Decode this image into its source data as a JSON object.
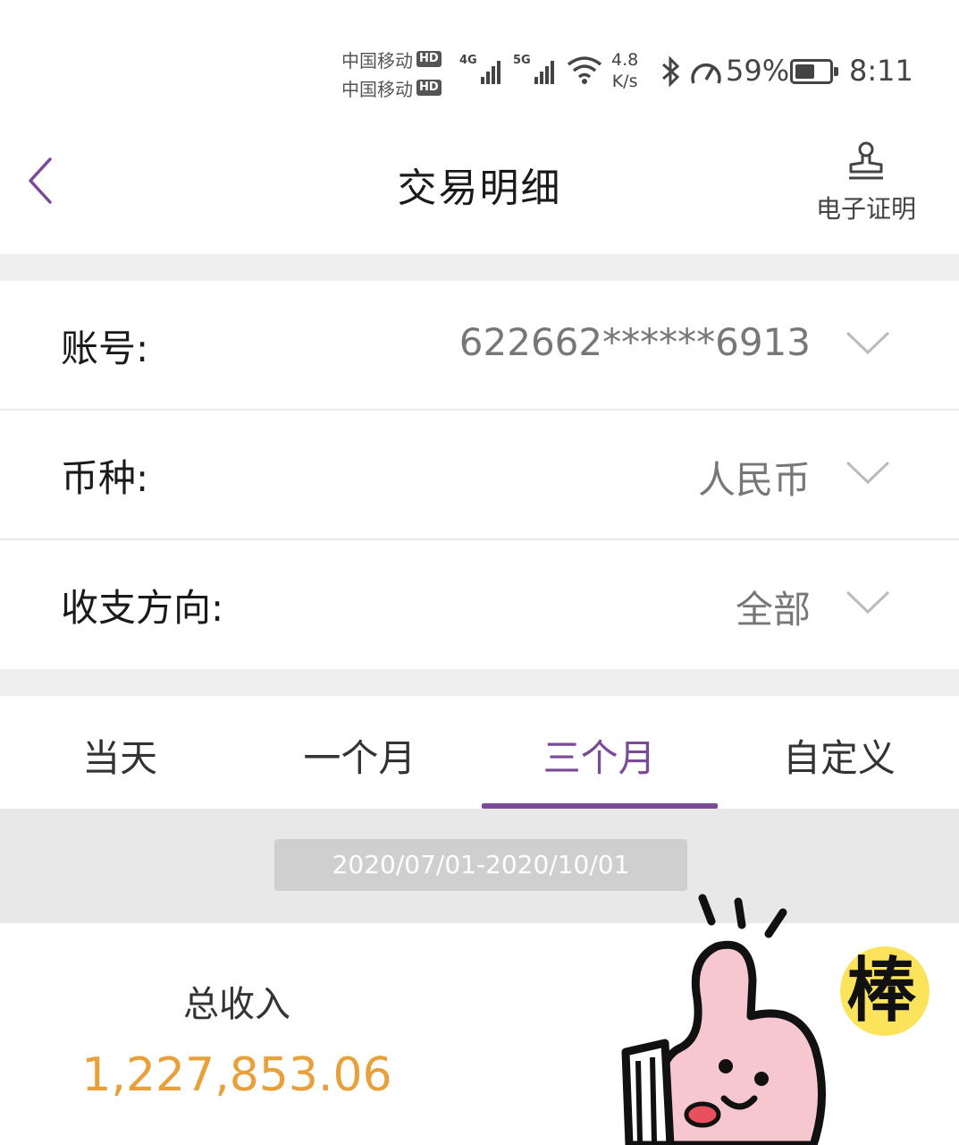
{
  "status_bar": {
    "carrier1": "中国移动",
    "carrier2": "中国移动",
    "hd_badge": "HD",
    "net1": "4G",
    "net2": "5G",
    "speed_value": "4.8",
    "speed_unit": "K/s",
    "battery_percent": "59%",
    "battery_level": 0.59,
    "time": "8:11"
  },
  "header": {
    "title": "交易明细",
    "cert_label": "电子证明"
  },
  "form": {
    "account_label": "账号:",
    "account_value": "622662******6913",
    "currency_label": "币种:",
    "currency_value": "人民币",
    "direction_label": "收支方向:",
    "direction_value": "全部"
  },
  "tabs": [
    {
      "label": "当天",
      "active": false
    },
    {
      "label": "一个月",
      "active": false
    },
    {
      "label": "三个月",
      "active": true
    },
    {
      "label": "自定义",
      "active": false
    }
  ],
  "date_range": "2020/07/01-2020/10/01",
  "summary": {
    "income_label": "总收入",
    "income_value": "1,227,853.06"
  },
  "sticker": {
    "text": "棒"
  },
  "colors": {
    "accent": "#7a4a96",
    "amount": "#e8a03a",
    "divider": "#efefef"
  }
}
